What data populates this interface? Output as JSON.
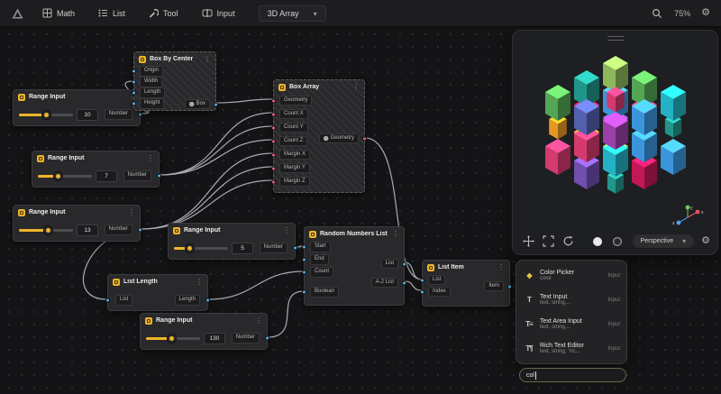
{
  "topbar": {
    "menus": [
      {
        "label": "Math"
      },
      {
        "label": "List"
      },
      {
        "label": "Tool"
      },
      {
        "label": "Input"
      }
    ],
    "preset": "3D Array",
    "zoom": "75%"
  },
  "nodes": [
    {
      "title": "Range Input",
      "value": "10",
      "output": "Number"
    },
    {
      "title": "Box By Center",
      "inputs": [
        "Origin",
        "Width",
        "Length",
        "Height"
      ],
      "output": "Box"
    },
    {
      "title": "Box Array",
      "inputs": [
        "Geometry",
        "Count X",
        "Count Y",
        "Count Z",
        "Margin X",
        "Margin Y",
        "Margin Z"
      ],
      "output": "Geometry"
    },
    {
      "title": "Range Input",
      "value": "7",
      "output": "Number"
    },
    {
      "title": "Range Input",
      "value": "13",
      "output": "Number"
    },
    {
      "title": "Range Input",
      "value": "5",
      "output": "Number"
    },
    {
      "title": "Random Numbers List",
      "inputs": [
        "Start",
        "End",
        "Count",
        "Boolean"
      ],
      "outputs": [
        "List",
        "A-2 List"
      ]
    },
    {
      "title": "List Length",
      "inputs": [
        "List"
      ],
      "output": "Length"
    },
    {
      "title": "List Item",
      "inputs": [
        "List",
        "Index"
      ],
      "output": "Item"
    },
    {
      "title": "Range Input",
      "value": "130",
      "output": "Number"
    }
  ],
  "viewport": {
    "projection": "Perspective",
    "axis": {
      "x": "x",
      "y": "y",
      "z": "z"
    },
    "accent_color": "#f0b429",
    "port_colors": {
      "number": "#4fb3e8",
      "geometry": "#e8638c"
    },
    "cubes": [
      {
        "i": 0,
        "j": 0,
        "k": 2,
        "c": "#9ccc65"
      },
      {
        "i": 1,
        "j": 0,
        "k": 2,
        "c": "#5cb85c"
      },
      {
        "i": 2,
        "j": 0,
        "k": 2,
        "c": "#26c6da"
      },
      {
        "i": 0,
        "j": 1,
        "k": 2,
        "c": "#26a69a"
      },
      {
        "i": 1,
        "j": 1,
        "k": 2,
        "c": "#ec407a",
        "s": 0.7
      },
      {
        "i": 2,
        "j": 1,
        "k": 2,
        "c": "#42a5f5"
      },
      {
        "i": 0,
        "j": 2,
        "k": 2,
        "c": "#5cb85c"
      },
      {
        "i": 1,
        "j": 2,
        "k": 2,
        "c": "#5c6bc0"
      },
      {
        "i": 2,
        "j": 2,
        "k": 2,
        "c": "#ab47bc"
      },
      {
        "i": 0,
        "j": 0,
        "k": 1,
        "c": "#42a5f5"
      },
      {
        "i": 1,
        "j": 0,
        "k": 1,
        "c": "#ec407a"
      },
      {
        "i": 2,
        "j": 0,
        "k": 1,
        "c": "#26a69a",
        "s": 0.65
      },
      {
        "i": 0,
        "j": 1,
        "k": 1,
        "c": "#d81b60"
      },
      {
        "i": 1,
        "j": 1,
        "k": 1,
        "c": "#ab47bc"
      },
      {
        "i": 2,
        "j": 1,
        "k": 1,
        "c": "#42a5f5"
      },
      {
        "i": 0,
        "j": 2,
        "k": 1,
        "c": "#ffa726",
        "s": 0.7
      },
      {
        "i": 1,
        "j": 2,
        "k": 1,
        "c": "#ec407a"
      },
      {
        "i": 2,
        "j": 2,
        "k": 1,
        "c": "#26c6da"
      },
      {
        "i": 0,
        "j": 0,
        "k": 0,
        "c": "#7e57c2"
      },
      {
        "i": 1,
        "j": 0,
        "k": 0,
        "c": "#5cb85c",
        "s": 0.7
      },
      {
        "i": 2,
        "j": 0,
        "k": 0,
        "c": "#42a5f5"
      },
      {
        "i": 0,
        "j": 1,
        "k": 0,
        "c": "#ffa726"
      },
      {
        "i": 1,
        "j": 1,
        "k": 0,
        "c": "#9ccc65"
      },
      {
        "i": 2,
        "j": 1,
        "k": 0,
        "c": "#d81b60"
      },
      {
        "i": 0,
        "j": 2,
        "k": 0,
        "c": "#ec407a"
      },
      {
        "i": 1,
        "j": 2,
        "k": 0,
        "c": "#7e57c2"
      },
      {
        "i": 2,
        "j": 2,
        "k": 0,
        "c": "#26a69a",
        "s": 0.65
      }
    ]
  },
  "palette": {
    "items": [
      {
        "glyph": "◆",
        "title": "Color Picker",
        "subtitle": "color",
        "tag": "Input"
      },
      {
        "glyph": "T",
        "title": "Text Input",
        "subtitle": "text, string,...",
        "tag": "Input"
      },
      {
        "glyph": "T≡",
        "title": "Text Area Input",
        "subtitle": "text, string,...",
        "tag": "Input"
      },
      {
        "glyph": "T¶",
        "title": "Rich Text Editor",
        "subtitle": "text, string, \"ric...",
        "tag": "Input"
      }
    ],
    "search_value": "col"
  }
}
